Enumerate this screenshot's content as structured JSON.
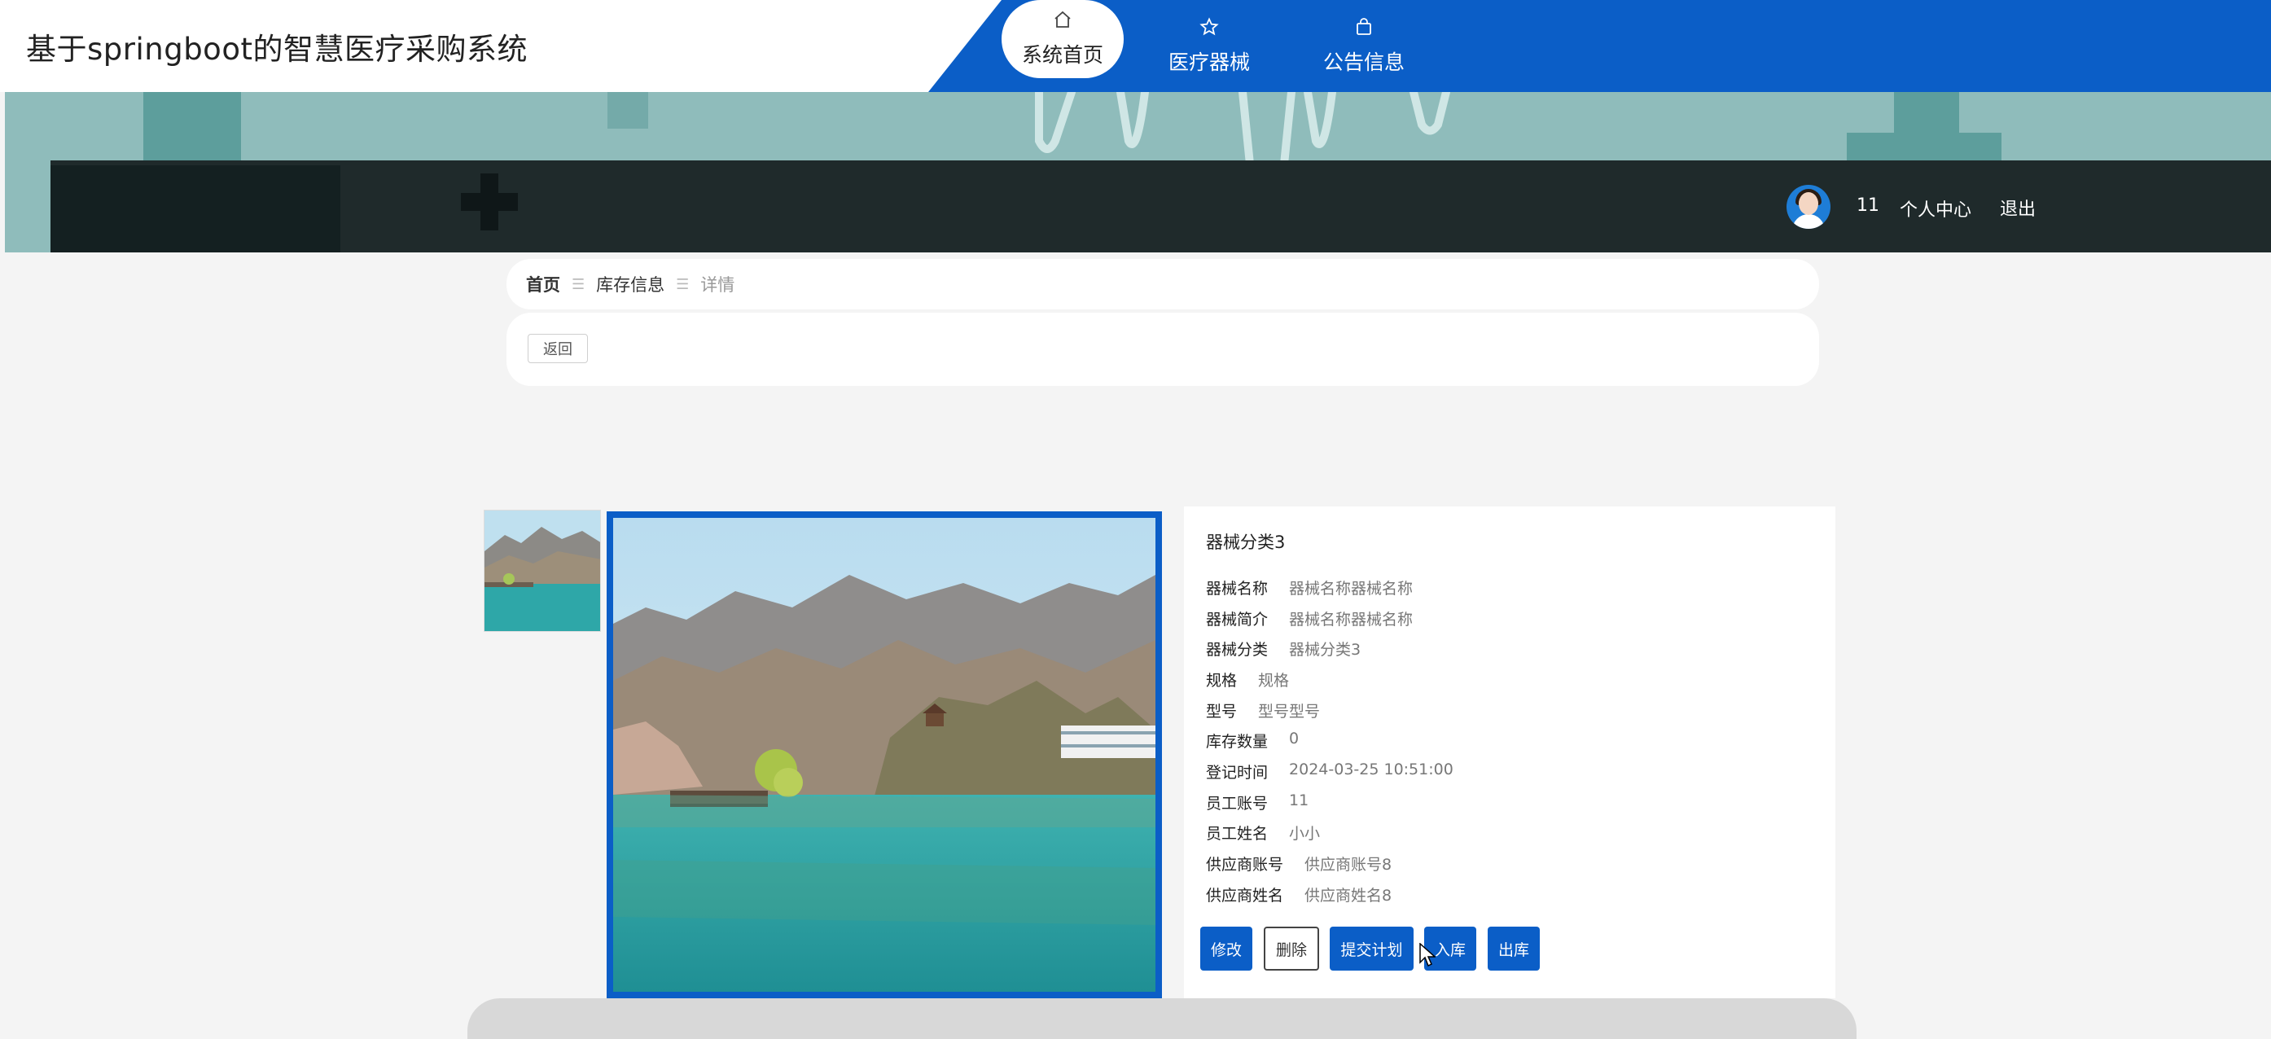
{
  "header": {
    "title": "基于springboot的智慧医疗采购系统",
    "nav": [
      {
        "label": "系统首页",
        "icon": "home-icon",
        "active": true
      },
      {
        "label": "医疗器械",
        "icon": "star-icon",
        "active": false
      },
      {
        "label": "公告信息",
        "icon": "bag-icon",
        "active": false
      }
    ]
  },
  "user": {
    "name": "11",
    "center_label": "个人中心",
    "logout_label": "退出"
  },
  "breadcrumb": [
    "首页",
    "库存信息",
    "详情"
  ],
  "actions": {
    "back_label": "返回"
  },
  "detail": {
    "heading": "器械分类3",
    "fields": [
      {
        "key": "器械名称",
        "value": "器械名称器械名称"
      },
      {
        "key": "器械简介",
        "value": "器械名称器械名称"
      },
      {
        "key": "器械分类",
        "value": "器械分类3"
      },
      {
        "key": "规格",
        "value": "规格"
      },
      {
        "key": "型号",
        "value": "型号型号"
      },
      {
        "key": "库存数量",
        "value": "0"
      },
      {
        "key": "登记时间",
        "value": "2024-03-25 10:51:00"
      },
      {
        "key": "员工账号",
        "value": "11"
      },
      {
        "key": "员工姓名",
        "value": "小小"
      },
      {
        "key": "供应商账号",
        "value": "供应商账号8"
      },
      {
        "key": "供应商姓名",
        "value": "供应商姓名8"
      }
    ],
    "buttons": {
      "edit": "修改",
      "delete": "删除",
      "submit_plan": "提交计划",
      "stock_in": "入库",
      "stock_out": "出库"
    }
  },
  "colors": {
    "primary": "#0b5ec7",
    "banner": "#8fbcbb",
    "banner_dark": "#1f2a2b"
  }
}
